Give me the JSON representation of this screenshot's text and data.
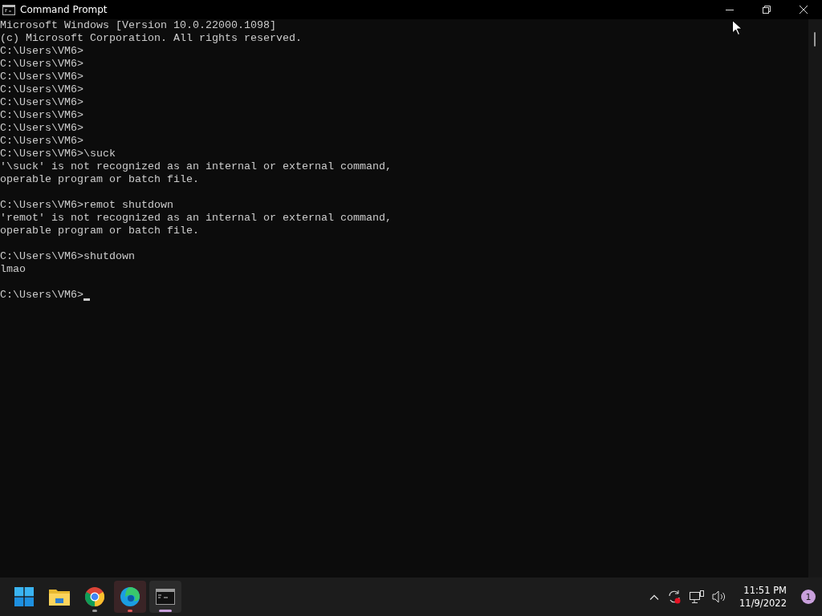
{
  "window": {
    "title": "Command Prompt"
  },
  "console": {
    "blocks": [
      [
        "Microsoft Windows [Version 10.0.22000.1098]",
        "(c) Microsoft Corporation. All rights reserved.",
        "C:\\Users\\VM6>",
        "C:\\Users\\VM6>",
        "C:\\Users\\VM6>",
        "C:\\Users\\VM6>",
        "C:\\Users\\VM6>",
        "C:\\Users\\VM6>",
        "C:\\Users\\VM6>",
        "C:\\Users\\VM6>",
        "C:\\Users\\VM6>\\suck",
        "'\\suck' is not recognized as an internal or external command,",
        "operable program or batch file."
      ],
      [
        "C:\\Users\\VM6>remot shutdown",
        "'remot' is not recognized as an internal or external command,",
        "operable program or batch file."
      ],
      [
        "C:\\Users\\VM6>shutdown",
        "lmao"
      ]
    ],
    "prompt": "C:\\Users\\VM6>",
    "cursor_visible": true
  },
  "taskbar": {
    "apps": [
      {
        "kind": "start",
        "running": false,
        "selected": false,
        "attention": false
      },
      {
        "kind": "folder",
        "running": false,
        "selected": false,
        "attention": false
      },
      {
        "kind": "chrome",
        "running": true,
        "selected": false,
        "attention": false
      },
      {
        "kind": "edge",
        "running": true,
        "selected": false,
        "attention": true
      },
      {
        "kind": "terminal",
        "running": true,
        "selected": true,
        "attention": false
      }
    ],
    "time": "11:51 PM",
    "date": "11/9/2022",
    "notification_count": "1"
  }
}
